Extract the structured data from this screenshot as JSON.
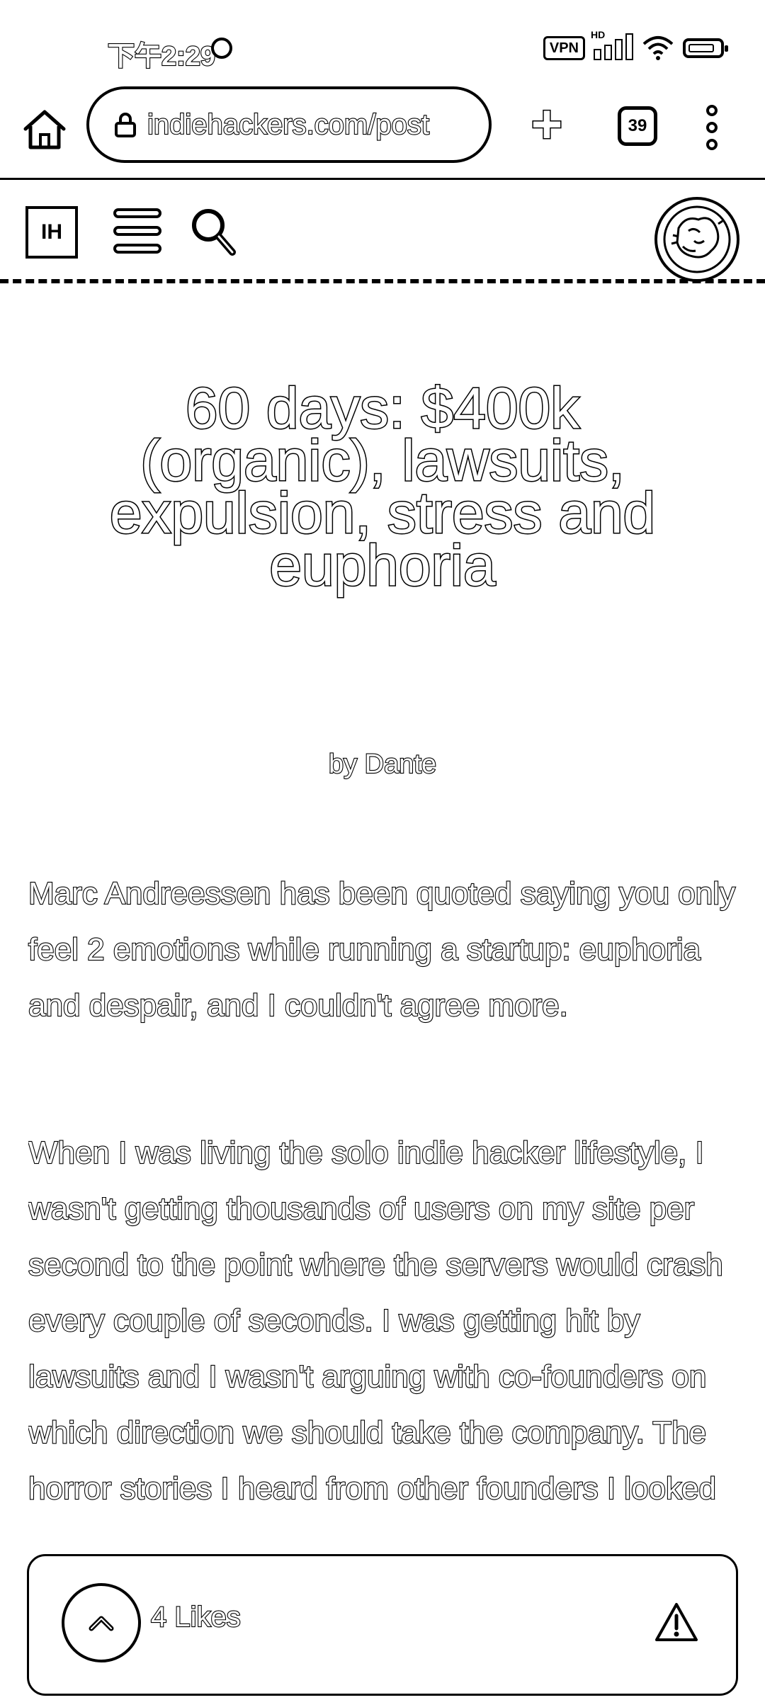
{
  "status_bar": {
    "time": "下午2:29",
    "vpn_label": "VPN",
    "hd_label": "HD"
  },
  "browser": {
    "url": "indiehackers.com/post",
    "tab_count": "39"
  },
  "site_header": {
    "logo_text": "IH"
  },
  "article": {
    "title": "60 days: $400k (organic), lawsuits, expulsion, stress and euphoria",
    "byline": "by Dante",
    "paragraphs": [
      "Marc Andreessen has been quoted saying you only feel 2 emotions while running a startup: euphoria and despair, and I couldn't agree more.",
      "When I was living the solo indie hacker lifestyle, I wasn't getting thousands of users on my site per second to the point where the servers would crash every couple of seconds. I was getting hit by lawsuits and I wasn't arguing with co-founders on which direction we should take the company. The horror stories I heard from other founders I looked"
    ]
  },
  "like_bar": {
    "likes_label": "4 Likes"
  },
  "icons": [
    "home-icon",
    "lock-icon",
    "plus-icon",
    "tabs-icon",
    "more-icon",
    "menu-icon",
    "search-icon",
    "avatar",
    "upvote-icon",
    "warning-icon"
  ]
}
